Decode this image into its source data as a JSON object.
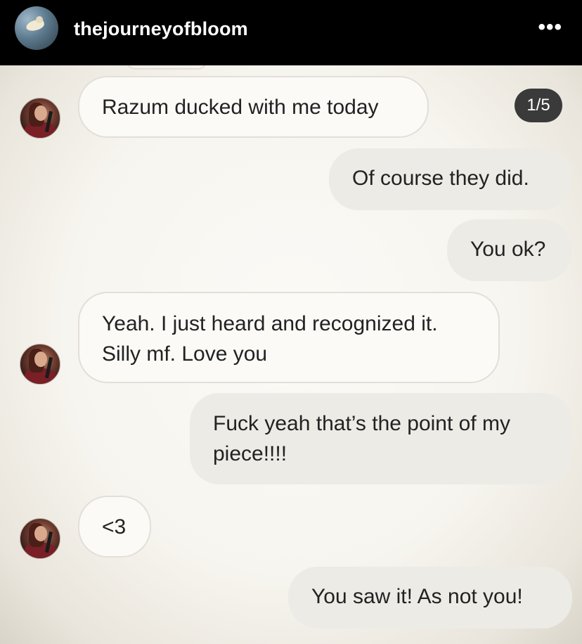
{
  "header": {
    "username": "thejourneyofbloom",
    "more_icon": "more-horizontal-icon",
    "more_glyph": "•••"
  },
  "pager": {
    "label": "1/5"
  },
  "messages": [
    {
      "side": "incoming",
      "text": "Razum ducked with me today"
    },
    {
      "side": "outgoing",
      "text": "Of course they did."
    },
    {
      "side": "outgoing",
      "text": "You ok?"
    },
    {
      "side": "incoming",
      "line1": "Yeah. I just heard and recognized it.",
      "line2": "Silly mf. Love you"
    },
    {
      "side": "outgoing",
      "line1": "Fuck yeah that’s the point of my",
      "line2": "piece!!!!"
    },
    {
      "side": "incoming",
      "text": "<3"
    },
    {
      "side": "outgoing",
      "text": "You saw it!  As not you!"
    }
  ]
}
